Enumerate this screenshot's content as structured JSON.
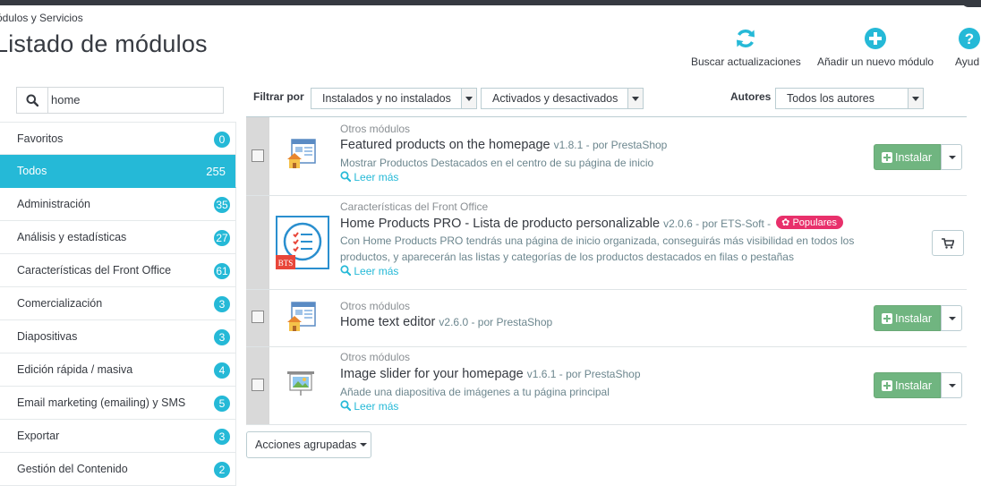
{
  "header": {
    "breadcrumb": "ódulos y Servicios",
    "title": "Listado de módulos",
    "toolbar": [
      {
        "label": "Buscar actualizaciones",
        "icon": "refresh-icon"
      },
      {
        "label": "Añadir un nuevo módulo",
        "icon": "plus-circle-icon"
      },
      {
        "label": "Ayud",
        "icon": "help-icon"
      }
    ]
  },
  "sidebar": {
    "search_value": "home",
    "categories": [
      {
        "label": "Favoritos",
        "count": "0"
      },
      {
        "label": "Todos",
        "count": "255",
        "active": true
      },
      {
        "label": "Administración",
        "count": "35"
      },
      {
        "label": "Análisis y estadísticas",
        "count": "27"
      },
      {
        "label": "Características del Front Office",
        "count": "61"
      },
      {
        "label": "Comercialización",
        "count": "3"
      },
      {
        "label": "Diapositivas",
        "count": "3"
      },
      {
        "label": "Edición rápida / masiva",
        "count": "4"
      },
      {
        "label": "Email marketing (emailing) y SMS",
        "count": "5"
      },
      {
        "label": "Exportar",
        "count": "3"
      },
      {
        "label": "Gestión del Contenido",
        "count": "2"
      }
    ]
  },
  "filters": {
    "label": "Filtrar por",
    "install_status": "Instalados y no instalados",
    "enable_status": "Activados y desactivados",
    "authors_label": "Autores",
    "authors": "Todos los autores"
  },
  "modules": [
    {
      "category": "Otros módulos",
      "name": "Featured products on the homepage",
      "version": "v1.8.1 - por PrestaShop",
      "description": "Mostrar Productos Destacados en el centro de su página de inicio",
      "more": "Leer más",
      "action": "Instalar"
    },
    {
      "category": "Características del Front Office",
      "name": "Home Products PRO - Lista de producto personalizable",
      "version": "v2.0.6 - por ETS-Soft -",
      "badge": "Populares",
      "description": "Con Home Products PRO tendrás una página de inicio organizada, conseguirás más visibilidad en todos los productos, y aparecerán las listas y categorías de los productos destacados en filas o pestañas",
      "more": "Leer más",
      "icon_text": "BTS"
    },
    {
      "category": "Otros módulos",
      "name": "Home text editor",
      "version": "v2.6.0 - por PrestaShop",
      "action": "Instalar"
    },
    {
      "category": "Otros módulos",
      "name": "Image slider for your homepage",
      "version": "v1.6.1 - por PrestaShop",
      "description": "Añade una diapositiva de imágenes a tu página principal",
      "more": "Leer más",
      "action": "Instalar"
    }
  ],
  "bulk_actions": "Acciones agrupadas",
  "colors": {
    "accent": "#25b9d7",
    "install": "#70b580",
    "popular": "#e8306b",
    "text": "#363a41"
  }
}
